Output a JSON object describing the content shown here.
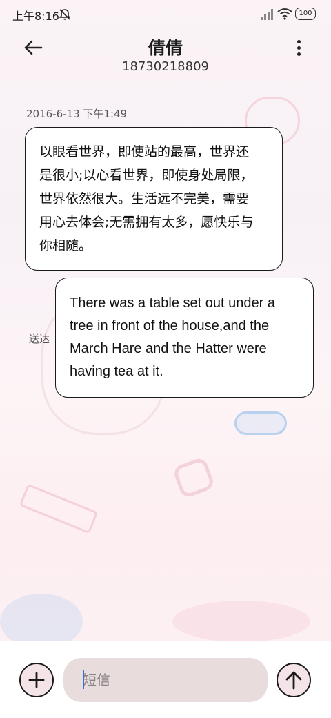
{
  "status_bar": {
    "time": "上午8:16",
    "battery": "100",
    "icons": [
      "bell-muted-icon",
      "signal-icon",
      "wifi-icon",
      "battery-icon"
    ]
  },
  "header": {
    "contact_name": "倩倩",
    "phone_number": "18730218809",
    "back_icon": "arrow-left-icon",
    "menu_icon": "more-vertical-icon"
  },
  "messages": [
    {
      "type": "received",
      "timestamp": "2016-6-13 下午1:49",
      "lines": [
        "以眼看世界，即使站的最高，世界还",
        "是很小;以心看世界，即使身处局限，",
        "世界依然很大。生活远不完美，需要",
        "用心去体会;无需拥有太多，愿快乐与",
        "你相随。"
      ]
    },
    {
      "type": "sent",
      "status": "送达",
      "lines": [
        "There was a table set out under a",
        "tree in front of the house,and the",
        "March Hare and the Hatter were",
        "having tea at it."
      ]
    }
  ],
  "composer": {
    "placeholder": "短信",
    "value": "",
    "add_icon": "plus-icon",
    "send_icon": "arrow-up-icon"
  },
  "colors": {
    "bubble_border": "#1a1a1a",
    "input_bg": "#e8dcdd",
    "button_bg": "#f4e4e7",
    "cursor": "#3a6fd8"
  }
}
